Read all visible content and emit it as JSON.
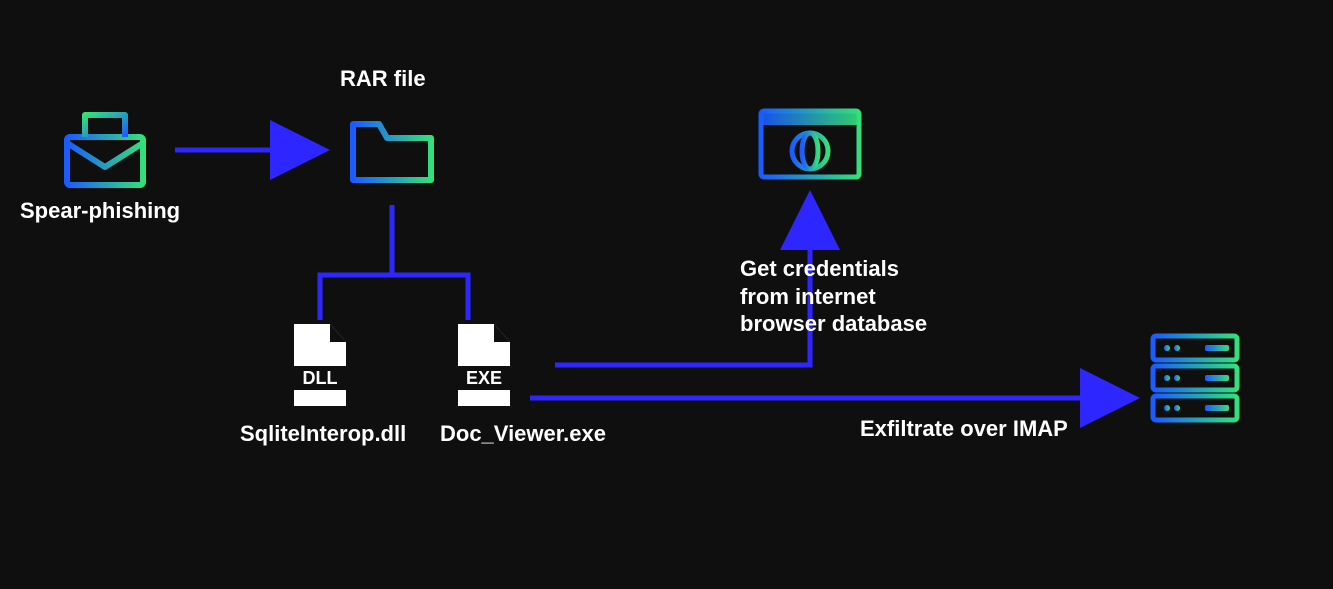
{
  "nodes": {
    "spear_phishing": {
      "label": "Spear-phishing"
    },
    "rar_file": {
      "label": "RAR file"
    },
    "dll_file": {
      "label": "SqliteInterop.dll",
      "badge": "DLL"
    },
    "exe_file": {
      "label": "Doc_Viewer.exe",
      "badge": "EXE"
    },
    "browser": {
      "label": "Get credentials\nfrom internet\nbrowser database"
    },
    "server": {
      "label": "Exfiltrate over IMAP"
    }
  },
  "colors": {
    "arrow": "#2d26ff",
    "grad_start": "#1a5cff",
    "grad_end": "#33e07a"
  }
}
